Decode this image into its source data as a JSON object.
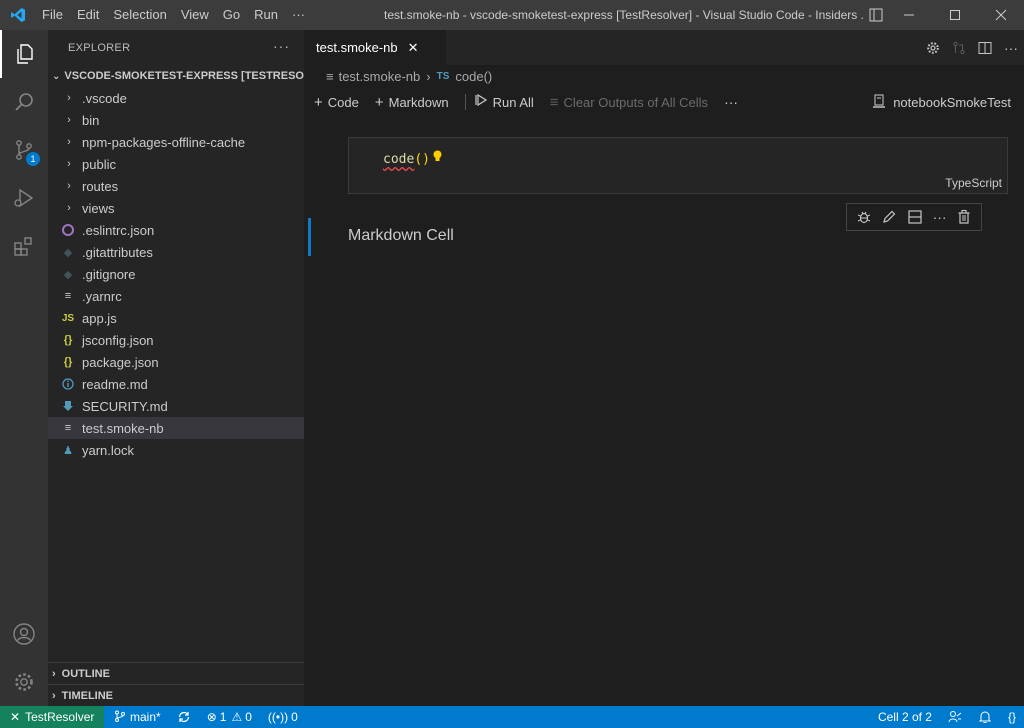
{
  "titlebar": {
    "menu": [
      "File",
      "Edit",
      "Selection",
      "View",
      "Go",
      "Run",
      "···"
    ],
    "title": "test.smoke-nb - vscode-smoketest-express [TestResolver] - Visual Studio Code - Insiders ...",
    "accent": "#23a9f2"
  },
  "activitybar": {
    "items": [
      "files-icon",
      "search-icon",
      "source-control-icon",
      "run-debug-icon",
      "extensions-icon"
    ],
    "scm_badge": "1",
    "bottom": [
      "accounts-icon",
      "manage-gear-icon"
    ]
  },
  "sidebar": {
    "title": "EXPLORER",
    "more": "···",
    "folder": "VSCODE-SMOKETEST-EXPRESS [TESTRESOL...",
    "folders": [
      ".vscode",
      "bin",
      "npm-packages-offline-cache",
      "public",
      "routes",
      "views"
    ],
    "files": [
      {
        "name": ".eslintrc.json",
        "icon": "eslint-icon"
      },
      {
        "name": ".gitattributes",
        "icon": "git-icon"
      },
      {
        "name": ".gitignore",
        "icon": "git-icon"
      },
      {
        "name": ".yarnrc",
        "icon": "lines-icon"
      },
      {
        "name": "app.js",
        "icon": "js-icon"
      },
      {
        "name": "jsconfig.json",
        "icon": "json-icon"
      },
      {
        "name": "package.json",
        "icon": "json-icon"
      },
      {
        "name": "readme.md",
        "icon": "info-icon"
      },
      {
        "name": "SECURITY.md",
        "icon": "download-icon"
      },
      {
        "name": "test.smoke-nb",
        "icon": "lines-icon"
      },
      {
        "name": "yarn.lock",
        "icon": "yarn-icon"
      }
    ],
    "outline": "OUTLINE",
    "timeline": "TIMELINE"
  },
  "editor": {
    "tab_label": "test.smoke-nb",
    "breadcrumb": {
      "file": "test.smoke-nb",
      "ts_badge": "TS",
      "symbol": "code()"
    },
    "toolbar": {
      "code": "Code",
      "markdown": "Markdown",
      "run_all": "Run All",
      "clear_outputs": "Clear Outputs of All Cells",
      "more": "···",
      "kernel": "notebookSmokeTest"
    },
    "code_cell": {
      "fn": "code",
      "parens": "()",
      "language": "TypeScript"
    },
    "markdown_cell": {
      "text": "Markdown Cell"
    }
  },
  "statusbar": {
    "remote": "TestResolver",
    "branch": "main*",
    "errors": "1",
    "warnings": "0",
    "ports": "0",
    "cell_position": "Cell 2 of 2",
    "braces": "{}"
  }
}
